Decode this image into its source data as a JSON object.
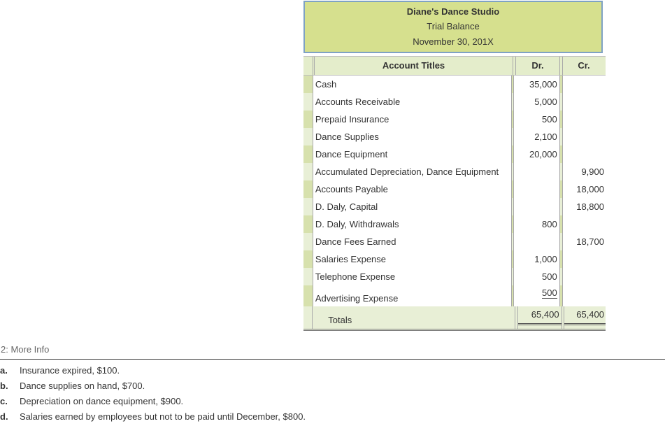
{
  "header": {
    "company": "Diane's Dance Studio",
    "report": "Trial Balance",
    "date": "November 30, 201X"
  },
  "columns": {
    "title": "Account Titles",
    "dr": "Dr.",
    "cr": "Cr."
  },
  "rows": [
    {
      "title": "Cash",
      "dr": "35,000",
      "cr": ""
    },
    {
      "title": "Accounts Receivable",
      "dr": "5,000",
      "cr": ""
    },
    {
      "title": "Prepaid Insurance",
      "dr": "500",
      "cr": ""
    },
    {
      "title": "Dance Supplies",
      "dr": "2,100",
      "cr": ""
    },
    {
      "title": "Dance Equipment",
      "dr": "20,000",
      "cr": ""
    },
    {
      "title": "Accumulated Depreciation, Dance Equipment",
      "dr": "",
      "cr": "9,900"
    },
    {
      "title": "Accounts Payable",
      "dr": "",
      "cr": "18,000"
    },
    {
      "title": "D. Daly, Capital",
      "dr": "",
      "cr": "18,800"
    },
    {
      "title": "D. Daly, Withdrawals",
      "dr": "800",
      "cr": ""
    },
    {
      "title": "Dance Fees Earned",
      "dr": "",
      "cr": "18,700"
    },
    {
      "title": "Salaries Expense",
      "dr": "1,000",
      "cr": ""
    },
    {
      "title": "Telephone Expense",
      "dr": "500",
      "cr": ""
    },
    {
      "title": "Advertising Expense",
      "dr": "500",
      "cr": ""
    }
  ],
  "totals": {
    "title": "Totals",
    "dr": "65,400",
    "cr": "65,400"
  },
  "more_info": {
    "label": "2: More Info",
    "items": [
      {
        "letter": "a.",
        "text": "Insurance expired, $100."
      },
      {
        "letter": "b.",
        "text": "Dance supplies on hand, $700."
      },
      {
        "letter": "c.",
        "text": "Depreciation on dance equipment, $900."
      },
      {
        "letter": "d.",
        "text": "Salaries earned by employees but not to be paid until December, $800."
      }
    ]
  }
}
